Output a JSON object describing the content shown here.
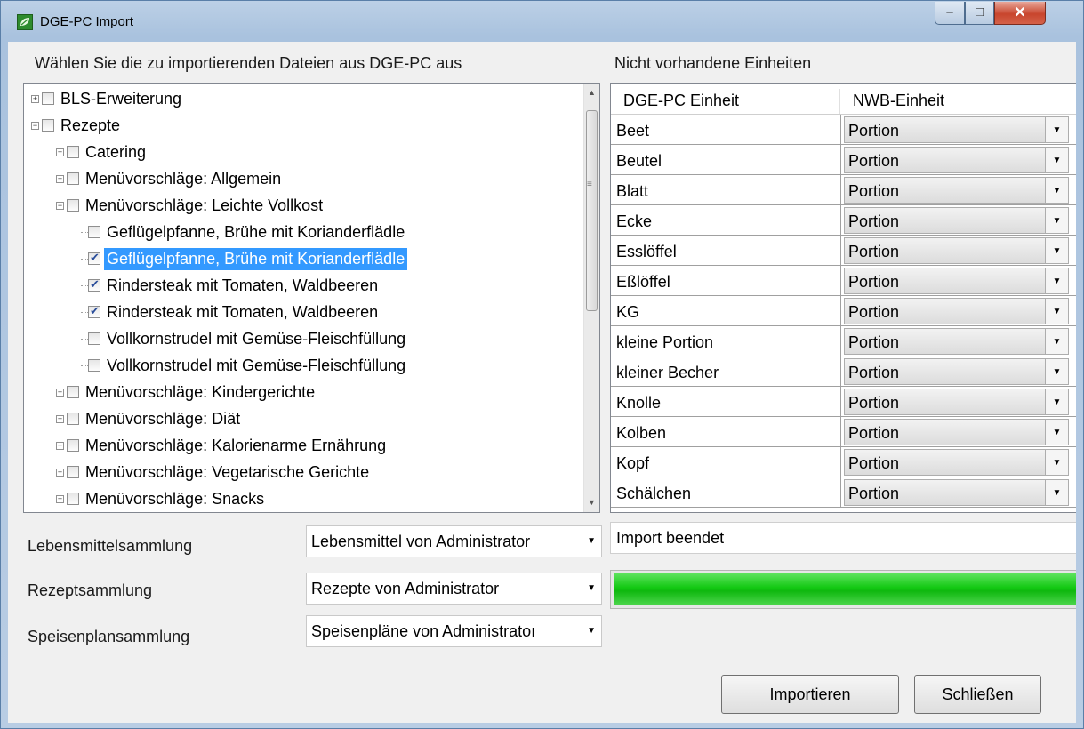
{
  "window": {
    "title": "DGE-PC Import"
  },
  "file_section": {
    "label": "Wählen Sie die zu importierenden Dateien aus DGE-PC aus"
  },
  "tree": [
    {
      "text": "BLS-Erweiterung",
      "checked": false,
      "expander": "+",
      "selected": false
    },
    {
      "text": "Rezepte",
      "checked": false,
      "expander": "−",
      "selected": false
    },
    {
      "text": "Catering",
      "checked": false,
      "expander": "+",
      "selected": false
    },
    {
      "text": "Menüvorschläge: Allgemein",
      "checked": false,
      "expander": "+",
      "selected": false
    },
    {
      "text": "Menüvorschläge: Leichte Vollkost",
      "checked": false,
      "expander": "−",
      "selected": false
    },
    {
      "text": "Geflügelpfanne, Brühe mit Korianderflädle",
      "checked": false,
      "expander": "",
      "selected": false
    },
    {
      "text": "Geflügelpfanne, Brühe mit Korianderflädle",
      "checked": true,
      "expander": "",
      "selected": true
    },
    {
      "text": "Rindersteak mit Tomaten, Waldbeeren",
      "checked": true,
      "expander": "",
      "selected": false
    },
    {
      "text": "Rindersteak mit Tomaten, Waldbeeren",
      "checked": true,
      "expander": "",
      "selected": false
    },
    {
      "text": "Vollkornstrudel mit Gemüse-Fleischfüllung",
      "checked": false,
      "expander": "",
      "selected": false
    },
    {
      "text": "Vollkornstrudel mit Gemüse-Fleischfüllung",
      "checked": false,
      "expander": "",
      "selected": false
    },
    {
      "text": "Menüvorschläge: Kindergerichte",
      "checked": false,
      "expander": "+",
      "selected": false
    },
    {
      "text": "Menüvorschläge: Diät",
      "checked": false,
      "expander": "+",
      "selected": false
    },
    {
      "text": "Menüvorschläge: Kalorienarme Ernährung",
      "checked": false,
      "expander": "+",
      "selected": false
    },
    {
      "text": "Menüvorschläge: Vegetarische Gerichte",
      "checked": false,
      "expander": "+",
      "selected": false
    },
    {
      "text": "Menüvorschläge: Snacks",
      "checked": false,
      "expander": "+",
      "selected": false
    }
  ],
  "units_section": {
    "label": "Nicht vorhandene Einheiten",
    "col1": "DGE-PC Einheit",
    "col2": "NWB-Einheit",
    "rows": [
      {
        "unit": "Beet",
        "mapped": "Portion"
      },
      {
        "unit": "Beutel",
        "mapped": "Portion"
      },
      {
        "unit": "Blatt",
        "mapped": "Portion"
      },
      {
        "unit": "Ecke",
        "mapped": "Portion"
      },
      {
        "unit": "Esslöffel",
        "mapped": "Portion"
      },
      {
        "unit": "Eßlöffel",
        "mapped": "Portion"
      },
      {
        "unit": "KG",
        "mapped": "Portion"
      },
      {
        "unit": "kleine Portion",
        "mapped": "Portion"
      },
      {
        "unit": "kleiner Becher",
        "mapped": "Portion"
      },
      {
        "unit": "Knolle",
        "mapped": "Portion"
      },
      {
        "unit": "Kolben",
        "mapped": "Portion"
      },
      {
        "unit": "Kopf",
        "mapped": "Portion"
      },
      {
        "unit": "Schälchen",
        "mapped": "Portion"
      }
    ]
  },
  "collections": {
    "food_label": "Lebensmittelsammlung",
    "food_value": "Lebensmittel von Administrator",
    "recipe_label": "Rezeptsammlung",
    "recipe_value": "Rezepte von Administrator",
    "plan_label": "Speisenplansammlung",
    "plan_value": "Speisenpläne von Administratoı"
  },
  "status": {
    "text": "Import beendet",
    "progress": 1.0,
    "progress_color": "#12c812"
  },
  "buttons": {
    "import": "Importieren",
    "close": "Schließen"
  },
  "icons": {
    "app": "leaf-icon",
    "dropdown": "dropdown-arrow-icon"
  }
}
